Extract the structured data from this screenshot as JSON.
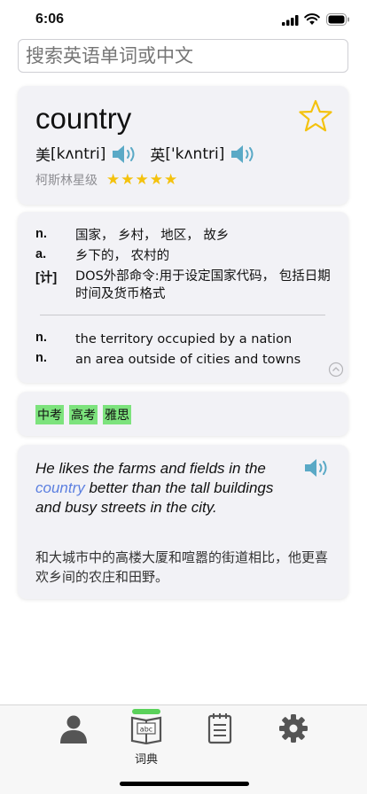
{
  "status_bar": {
    "time": "6:06"
  },
  "search": {
    "placeholder": "搜索英语单词或中文"
  },
  "word_card": {
    "word": "country",
    "us_label": "美",
    "us_phonetic": "[kʌntri]",
    "uk_label": "英",
    "uk_phonetic": "['kʌntri]",
    "rating_label": "柯斯林星级",
    "rating_stars": 5,
    "stars_text": "★★★★★"
  },
  "definitions": {
    "chinese": [
      {
        "pos": "n.",
        "meaning": "国家， 乡村， 地区， 故乡"
      },
      {
        "pos": "a.",
        "meaning": "乡下的， 农村的"
      },
      {
        "pos": "[计]",
        "meaning": "DOS外部命令:用于设定国家代码， 包括日期时间及货币格式"
      }
    ],
    "english": [
      {
        "pos": "n.",
        "meaning": "the territory occupied by a nation"
      },
      {
        "pos": "n.",
        "meaning": "an area outside of cities and towns"
      }
    ]
  },
  "tags": [
    "中考",
    "高考",
    "雅思"
  ],
  "example": {
    "en_before": "He likes the farms and fields in the ",
    "en_highlight": "country",
    "en_after": " better than the tall buildings and busy streets in the city.",
    "cn": "和大城市中的高楼大厦和喧嚣的街道相比，他更喜欢乡间的农庄和田野。"
  },
  "tabbar": {
    "tabs": [
      {
        "name": "profile",
        "label": ""
      },
      {
        "name": "dictionary",
        "label": "词典",
        "active": true
      },
      {
        "name": "notebook",
        "label": ""
      },
      {
        "name": "settings",
        "label": ""
      }
    ]
  },
  "colors": {
    "accent_speaker": "#5aa9c6",
    "star": "#f4c20d",
    "tag_bg": "#7de37d",
    "highlight": "#5b7fe0"
  }
}
